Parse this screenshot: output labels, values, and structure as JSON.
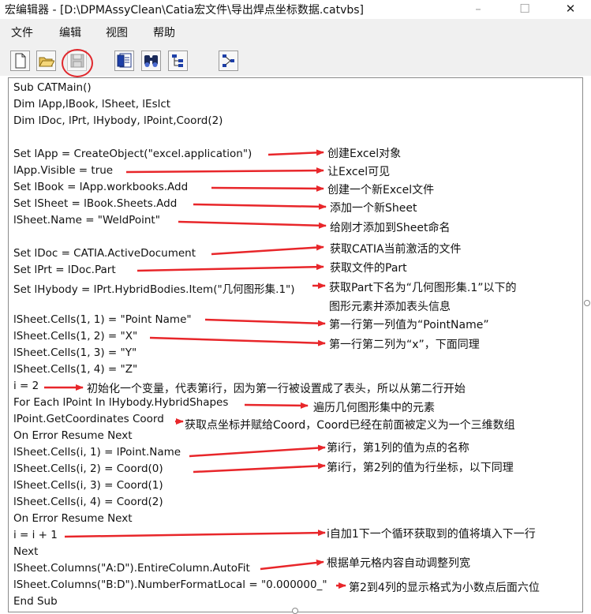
{
  "window": {
    "title": "宏编辑器 - [D:\\DPMAssyClean\\Catia宏文件\\导出焊点坐标数据.catvbs]",
    "minimize_glyph": "–",
    "maximize_glyph": "☐",
    "close_glyph": "✕"
  },
  "menu": {
    "file": "文件",
    "edit": "编辑",
    "view": "视图",
    "help": "帮助"
  },
  "toolbar": {
    "icons": [
      "new-file-icon",
      "open-folder-icon",
      "save-icon",
      "dialog-icon",
      "find-icon",
      "object-tree-icon",
      "graph-icon"
    ],
    "highlight_color": "#e0282d"
  },
  "code": {
    "lines": [
      "Sub CATMain()",
      "Dim lApp,lBook, lSheet, lEslct",
      "Dim lDoc, lPrt, lHybody, lPoint,Coord(2)",
      "",
      "Set lApp = CreateObject(\"excel.application\")",
      "lApp.Visible = true",
      "Set lBook = lApp.workbooks.Add",
      "Set lSheet = lBook.Sheets.Add",
      "lSheet.Name = \"WeldPoint\"",
      "",
      "Set lDoc = CATIA.ActiveDocument",
      "Set lPrt = lDoc.Part",
      "Set lHybody = lPrt.HybridBodies.Item(\"几何图形集.1\")",
      "",
      "lSheet.Cells(1, 1) = \"Point Name\"",
      "lSheet.Cells(1, 2) = \"X\"",
      "lSheet.Cells(1, 3) = \"Y\"",
      "lSheet.Cells(1, 4) = \"Z\"",
      "i = 2",
      "For Each lPoint In lHybody.HybridShapes",
      "lPoint.GetCoordinates Coord",
      "On Error Resume Next",
      "lSheet.Cells(i, 1) = lPoint.Name",
      "lSheet.Cells(i, 2) = Coord(0)",
      "lSheet.Cells(i, 3) = Coord(1)",
      "lSheet.Cells(i, 4) = Coord(2)",
      "On Error Resume Next",
      "i = i + 1",
      "Next",
      "lSheet.Columns(\"A:D\").EntireColumn.AutoFit",
      "lSheet.Columns(\"B:D\").NumberFormatLocal = \"0.000000_\"",
      "End Sub"
    ]
  },
  "annotations": [
    "创建Excel对象",
    "让Excel可见",
    "创建一个新Excel文件",
    "添加一个新Sheet",
    "给刚才添加到Sheet命名",
    "获取CATIA当前激活的文件",
    "获取文件的Part",
    "获取Part下名为“几何图形集.1”以下的",
    "图形元素并添加表头信息",
    "第一行第一列值为“PointName”",
    "第一行第二列为“x”，下面同理",
    "初始化一个变量，代表第i行，因为第一行被设置成了表头，所以从第二行开始",
    "遍历几何图形集中的元素",
    "获取点坐标并赋给Coord，Coord已经在前面被定义为一个三维数组",
    "第i行，第1列的值为点的名称",
    "第i行，第2列的值为行坐标，以下同理",
    "i自加1下一个循环获取到的值将填入下一行",
    "根据单元格内容自动调整列宽",
    "第2到4列的显示格式为小数点后面六位"
  ],
  "arrow_color": "#e8262a"
}
